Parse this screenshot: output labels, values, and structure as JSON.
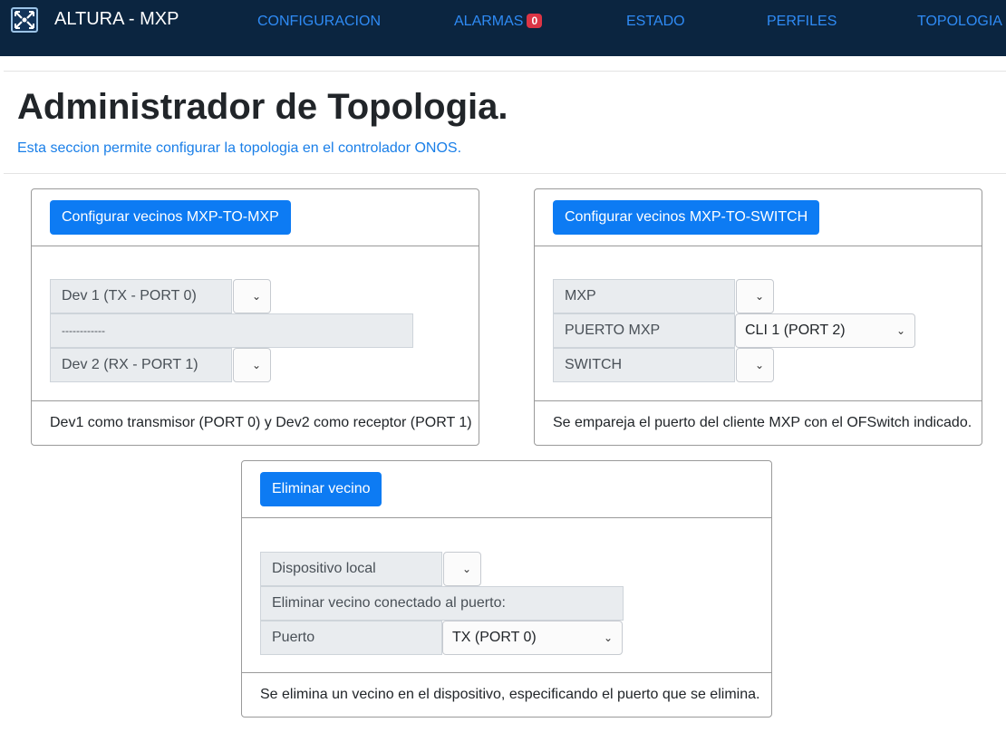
{
  "navbar": {
    "brand": "ALTURA - MXP",
    "links": {
      "config": "CONFIGURACION",
      "alarms": "ALARMAS",
      "alarm_count": "0",
      "status": "ESTADO",
      "profiles": "PERFILES",
      "topology": "TOPOLOGIA"
    }
  },
  "page": {
    "title": "Administrador de Topologia.",
    "subtitle": "Esta seccion permite configurar la topologia en el controlador ONOS."
  },
  "card_mxp_mxp": {
    "button": "Configurar vecinos MXP-TO-MXP",
    "dev1_label": "Dev 1 (TX - PORT 0)",
    "separator": "------------",
    "dev2_label": "Dev 2 (RX - PORT 1)",
    "footer": "Dev1 como transmisor (PORT 0) y Dev2 como receptor (PORT 1)"
  },
  "card_mxp_switch": {
    "button": "Configurar vecinos MXP-TO-SWITCH",
    "mxp_label": "MXP",
    "port_label": "PUERTO MXP",
    "port_value": "CLI 1 (PORT 2)",
    "switch_label": "SWITCH",
    "footer": "Se empareja el puerto del cliente MXP con el OFSwitch indicado."
  },
  "card_delete": {
    "button": "Eliminar vecino",
    "device_label": "Dispositivo local",
    "info_label": "Eliminar vecino conectado al puerto:",
    "port_label": "Puerto",
    "port_value": "TX (PORT 0)",
    "footer": "Se elimina un vecino en el dispositivo, especificando el puerto que se elimina."
  },
  "icons": {
    "brand": "network-arrows-icon",
    "dropdown": "chevron-down-icon"
  },
  "colors": {
    "navbar_bg": "#0b2540",
    "nav_link": "#2f8bf5",
    "primary_button": "#0d7bf3",
    "badge": "#dc3545",
    "subtitle": "#1a7fe8"
  }
}
